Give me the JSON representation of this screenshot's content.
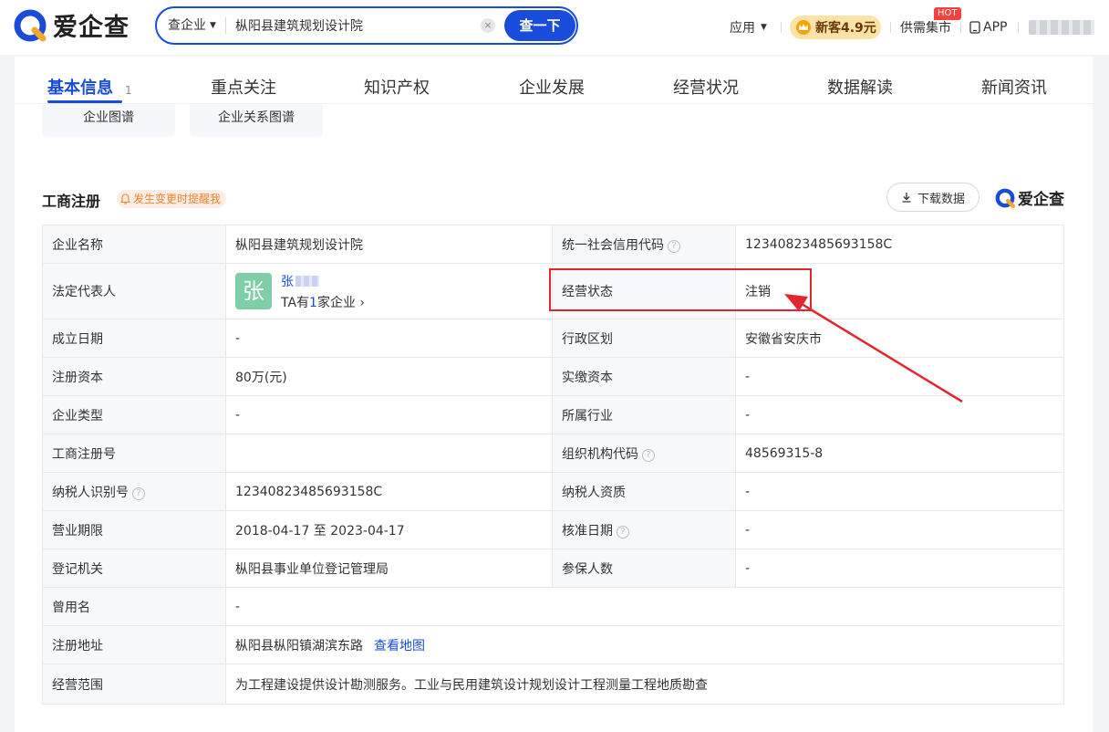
{
  "header": {
    "brand": "爱企查",
    "search_type": "查企业",
    "search_value": "枞阳县建筑规划设计院",
    "search_button": "查一下",
    "nav_apps": "应用",
    "promo": "新客4.9元",
    "market": "供需集市",
    "hot_badge": "HOT",
    "app": "APP"
  },
  "tabs": [
    {
      "label": "基本信息",
      "badge": "1"
    },
    {
      "label": "重点关注"
    },
    {
      "label": "知识产权"
    },
    {
      "label": "企业发展"
    },
    {
      "label": "经营状况"
    },
    {
      "label": "数据解读"
    },
    {
      "label": "新闻资讯"
    }
  ],
  "sub_buttons": [
    "企业图谱",
    "企业关系图谱"
  ],
  "section": {
    "title": "工商注册",
    "remind": "发生变更时提醒我",
    "download": "下载数据",
    "brand": "爱企查"
  },
  "registration": {
    "company_name": {
      "label": "企业名称",
      "value": "枞阳县建筑规划设计院"
    },
    "credit_code": {
      "label": "统一社会信用代码",
      "value": "12340823485693158C"
    },
    "legal_rep": {
      "label": "法定代表人",
      "avatar": "张",
      "name": "张",
      "sub_prefix": "TA有",
      "sub_count": "1",
      "sub_suffix": "家企业"
    },
    "status": {
      "label": "经营状态",
      "value": "注销"
    },
    "found_date": {
      "label": "成立日期",
      "value": "-"
    },
    "region": {
      "label": "行政区划",
      "value": "安徽省安庆市"
    },
    "reg_capital": {
      "label": "注册资本",
      "value": "80万(元)"
    },
    "paid_capital": {
      "label": "实缴资本",
      "value": "-"
    },
    "company_type": {
      "label": "企业类型",
      "value": "-"
    },
    "industry": {
      "label": "所属行业",
      "value": "-"
    },
    "reg_no": {
      "label": "工商注册号",
      "value": ""
    },
    "org_code": {
      "label": "组织机构代码",
      "value": "48569315-8"
    },
    "taxpayer_id": {
      "label": "纳税人识别号",
      "value": "12340823485693158C"
    },
    "taxpayer_qual": {
      "label": "纳税人资质",
      "value": "-"
    },
    "term": {
      "label": "营业期限",
      "value": "2018-04-17 至 2023-04-17"
    },
    "approve_date": {
      "label": "核准日期",
      "value": "-"
    },
    "authority": {
      "label": "登记机关",
      "value": "枞阳县事业单位登记管理局"
    },
    "insured": {
      "label": "参保人数",
      "value": "-"
    },
    "former_name": {
      "label": "曾用名",
      "value": "-"
    },
    "address": {
      "label": "注册地址",
      "value": "枞阳县枞阳镇湖滨东路",
      "link": "查看地图"
    },
    "scope": {
      "label": "经营范围",
      "value": "为工程建设提供设计勘测服务。工业与民用建筑设计规划设计工程测量工程地质勘查"
    }
  },
  "colors": {
    "brand_blue": "#1a4cdb",
    "annotation_red": "#e3262d",
    "remind_orange": "#f0822c"
  }
}
